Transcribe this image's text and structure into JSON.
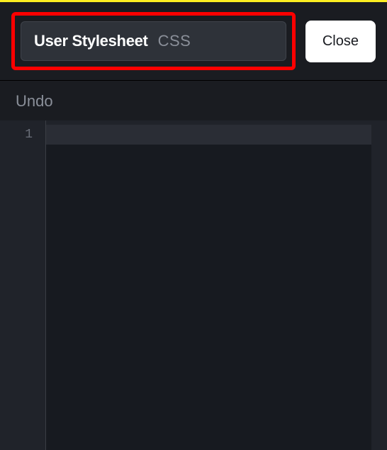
{
  "header": {
    "title": "User Stylesheet",
    "badge": "CSS",
    "close_label": "Close"
  },
  "toolbar": {
    "undo_label": "Undo"
  },
  "editor": {
    "line_numbers": [
      "1"
    ],
    "content": ""
  },
  "highlight": {
    "color": "#ff0000"
  }
}
